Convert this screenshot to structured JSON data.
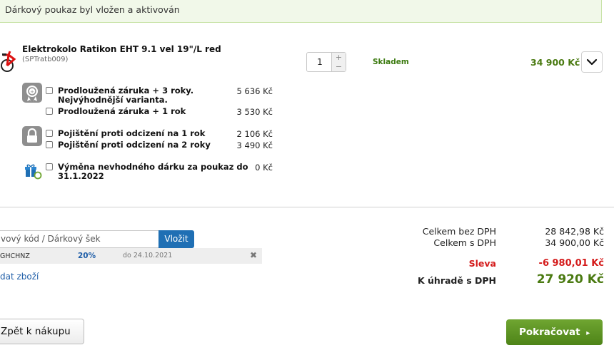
{
  "notice": {
    "text": "Dárkový poukaz byl vložen a aktivován"
  },
  "product": {
    "name": "Elektrokolo Ratikon EHT 9.1 vel 19\"/L red",
    "code": "(SPTratb009)",
    "quantity": "1",
    "stock": "Skladem",
    "price": "34 900 Kč",
    "qty_plus": "+",
    "qty_minus": "−",
    "icon": "bicycle-icon"
  },
  "services": [
    {
      "icon": "warranty-medal-icon",
      "options": [
        {
          "label_line1": "Prodloužená záruka + 3 roky.",
          "label_line2": "Nejvýhodnější varianta.",
          "price": "5 636 Kč",
          "checked": false
        },
        {
          "label_line1": "Prodloužená záruka + 1 rok",
          "label_line2": "",
          "price": "3 530 Kč",
          "checked": false
        }
      ]
    },
    {
      "icon": "padlock-icon",
      "options": [
        {
          "label_line1": "Pojištění proti odcizení na 1 rok",
          "label_line2": "",
          "price": "2 106 Kč",
          "checked": false
        },
        {
          "label_line1": "Pojištění proti odcizení na 2 roky",
          "label_line2": "",
          "price": "3 490 Kč",
          "checked": false
        }
      ]
    },
    {
      "icon": "gift-exchange-icon",
      "options": [
        {
          "label_line1": "Výměna nevhodného dárku za poukaz do",
          "label_line2": "31.1.2022",
          "price": "0 Kč",
          "checked": false
        }
      ]
    }
  ],
  "discount": {
    "input_value": "vový kód / Dárkový šek",
    "button": "Vložit",
    "applied": {
      "code": "GHCHNZ",
      "percent": "20%",
      "valid": "do 24.10.2021",
      "remove": "✖"
    },
    "add_link": "dat zboží"
  },
  "summary": {
    "without_vat_label": "Celkem bez DPH",
    "without_vat": "28 842,98 Kč",
    "with_vat_label": "Celkem s DPH",
    "with_vat": "34 900,00 Kč",
    "discount_label": "Sleva",
    "discount": "-6 980,01 Kč",
    "to_pay_label": "K úhradě s DPH",
    "to_pay": "27 920 Kč"
  },
  "nav": {
    "back": "Zpět k nákupu",
    "continue": "Pokračovat",
    "continue_arrow": "▸"
  },
  "colors": {
    "accent_green": "#4e8418",
    "price_green": "#4a7a11",
    "link_blue": "#1f5ea8",
    "discount_red": "#d41a1a",
    "notice_bg": "#f1f8e9"
  }
}
